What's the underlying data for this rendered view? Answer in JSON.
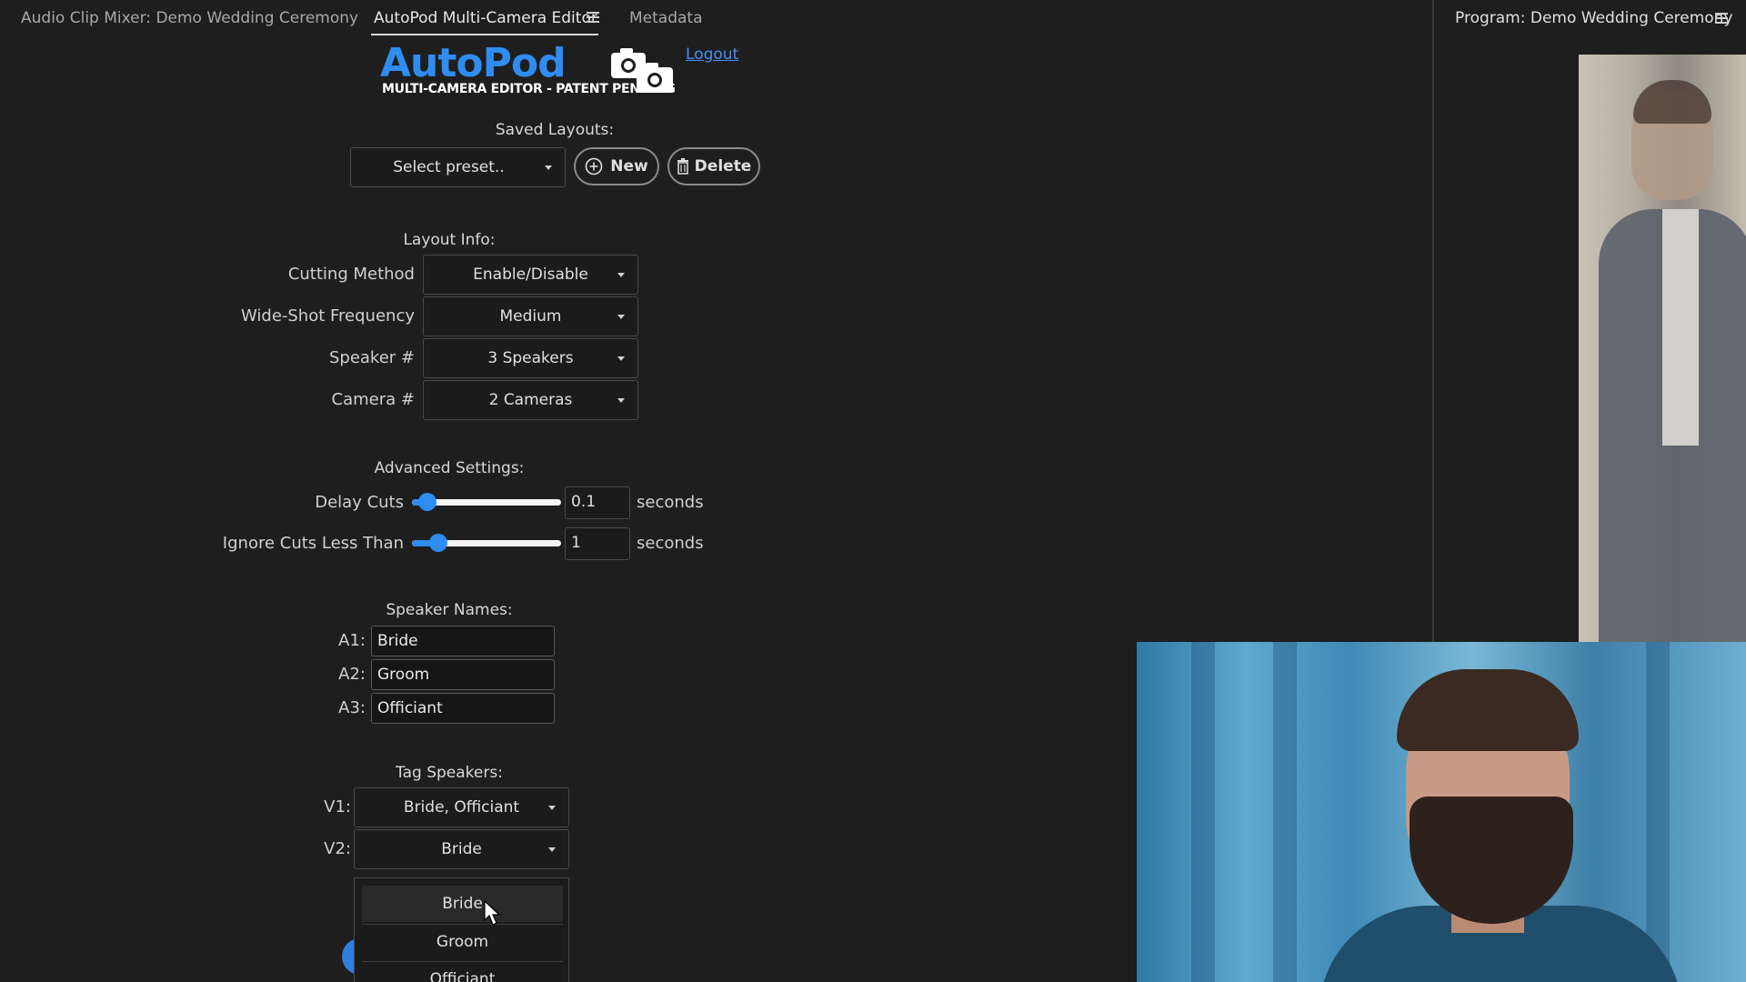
{
  "tabs": {
    "audio_mixer": "Audio Clip Mixer: Demo Wedding Ceremony",
    "autopod": "AutoPod Multi-Camera Editor",
    "metadata": "Metadata"
  },
  "logo": {
    "title": "AutoPod",
    "subtitle": "MULTI-CAMERA EDITOR - PATENT PENDING",
    "logout": "Logout",
    "brand_color": "#2f8cf0"
  },
  "saved_layouts": {
    "title": "Saved Layouts:",
    "preset_placeholder": "Select preset..",
    "new_label": "New",
    "delete_label": "Delete"
  },
  "layout_info": {
    "title": "Layout Info:",
    "cutting_method": {
      "label": "Cutting Method",
      "value": "Enable/Disable"
    },
    "wide_shot_frequency": {
      "label": "Wide-Shot Frequency",
      "value": "Medium"
    },
    "speaker_count": {
      "label": "Speaker #",
      "value": "3 Speakers"
    },
    "camera_count": {
      "label": "Camera #",
      "value": "2 Cameras"
    }
  },
  "advanced": {
    "title": "Advanced Settings:",
    "delay_cuts": {
      "label": "Delay Cuts",
      "value": "0.1",
      "unit": "seconds",
      "slider_fraction": 0.05
    },
    "ignore_cuts": {
      "label": "Ignore Cuts Less Than",
      "value": "1",
      "unit": "seconds",
      "slider_fraction": 0.13
    }
  },
  "speaker_names": {
    "title": "Speaker Names:",
    "a1": {
      "label": "A1:",
      "value": "Bride"
    },
    "a2": {
      "label": "A2:",
      "value": "Groom"
    },
    "a3": {
      "label": "A3:",
      "value": "Officiant"
    }
  },
  "tag_speakers": {
    "title": "Tag Speakers:",
    "v1": {
      "label": "V1:",
      "value": "Bride, Officiant"
    },
    "v2": {
      "label": "V2:",
      "value": "Bride"
    },
    "options": [
      "Bride",
      "Groom",
      "Officiant"
    ]
  },
  "program": {
    "title": "Program: Demo Wedding Ceremony"
  }
}
